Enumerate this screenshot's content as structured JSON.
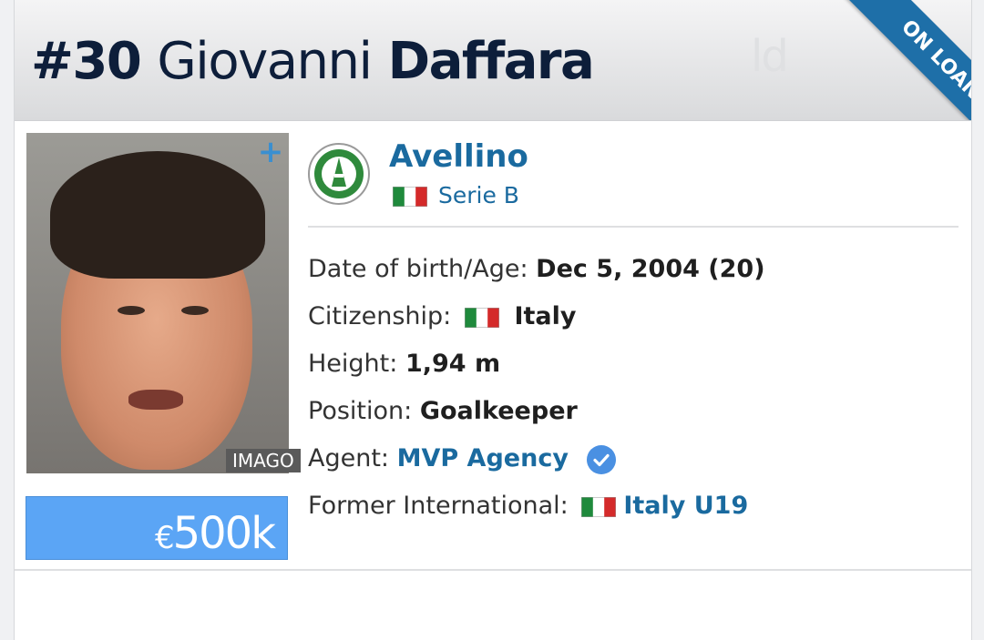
{
  "header": {
    "number": "#30",
    "first_name": "Giovanni",
    "last_name": "Daffara",
    "watermark": "ld",
    "ribbon": "ON LOAN"
  },
  "photo": {
    "credit": "IMAGO",
    "add_icon": "plus-icon"
  },
  "market_value": {
    "currency": "€",
    "amount": "500k"
  },
  "club": {
    "name": "Avellino",
    "league": "Serie B",
    "league_flag": "italy-flag"
  },
  "details": {
    "dob_label": "Date of birth/Age:",
    "dob_value": "Dec 5, 2004 (20)",
    "citizenship_label": "Citizenship:",
    "citizenship_value": "Italy",
    "height_label": "Height:",
    "height_value": "1,94 m",
    "position_label": "Position:",
    "position_value": "Goalkeeper",
    "agent_label": "Agent:",
    "agent_value": "MVP Agency",
    "agent_verified_icon": "verified-check-icon",
    "former_international_label": "Former International:",
    "former_international_value": "Italy U19"
  },
  "colors": {
    "title": "#0d1e3a",
    "link": "#1a6a9f",
    "ribbon": "#1e6fa8",
    "value_box": "#5ba5f5",
    "verified": "#4a90e2"
  }
}
